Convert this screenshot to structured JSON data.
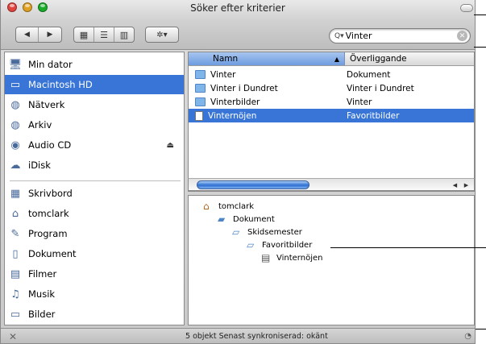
{
  "window": {
    "title": "Söker efter kriterier"
  },
  "toolbar": {
    "back_glyph": "◀",
    "forward_glyph": "▶",
    "view_icon_glyph": "▦",
    "view_list_glyph": "☰",
    "view_column_glyph": "▥",
    "action_glyph": "✲▾"
  },
  "search": {
    "value": "Vinter",
    "icon_glyph": "Q▾",
    "clear_glyph": "✕"
  },
  "sidebar": {
    "devices": [
      {
        "label": "Min dator",
        "icon": "computer-icon",
        "glyph": "🖥"
      },
      {
        "label": "Macintosh HD",
        "icon": "hard-disk-icon",
        "glyph": "▭",
        "selected": true
      },
      {
        "label": "Nätverk",
        "icon": "network-icon",
        "glyph": "◍"
      },
      {
        "label": "Arkiv",
        "icon": "archive-disk-icon",
        "glyph": "◍"
      },
      {
        "label": "Audio CD",
        "icon": "cd-icon",
        "glyph": "◉"
      },
      {
        "label": "iDisk",
        "icon": "idisk-icon",
        "glyph": "☁"
      }
    ],
    "eject_glyph": "⏏",
    "places": [
      {
        "label": "Skrivbord",
        "icon": "desktop-icon",
        "glyph": "▦"
      },
      {
        "label": "tomclark",
        "icon": "home-icon",
        "glyph": "⌂"
      },
      {
        "label": "Program",
        "icon": "applications-icon",
        "glyph": "✎"
      },
      {
        "label": "Dokument",
        "icon": "document-icon",
        "glyph": "▯"
      },
      {
        "label": "Filmer",
        "icon": "movies-icon",
        "glyph": "▤"
      },
      {
        "label": "Musik",
        "icon": "music-icon",
        "glyph": "♫"
      },
      {
        "label": "Bilder",
        "icon": "pictures-icon",
        "glyph": "▭"
      }
    ]
  },
  "filelist": {
    "columns": {
      "name": "Namn",
      "parent": "Överliggande"
    },
    "sort_glyph": "▲",
    "rows": [
      {
        "name": "Vinter",
        "parent": "Dokument",
        "icon": "folder-icon",
        "selected": false
      },
      {
        "name": "Vinter i Dundret",
        "parent": "Vinter i Dundret",
        "icon": "folder-icon",
        "selected": false
      },
      {
        "name": "Vinterbilder",
        "parent": "Vinter",
        "icon": "folder-icon",
        "selected": false
      },
      {
        "name": "Vinternöjen",
        "parent": "Favoritbilder",
        "icon": "file-icon",
        "selected": true
      }
    ]
  },
  "path": [
    {
      "label": "tomclark",
      "icon": "home-icon",
      "glyph": "⌂"
    },
    {
      "label": "Dokument",
      "icon": "document-folder-icon",
      "glyph": "▰"
    },
    {
      "label": "Skidsemester",
      "icon": "folder-icon",
      "glyph": "▱"
    },
    {
      "label": "Favoritbilder",
      "icon": "folder-icon",
      "glyph": "▱"
    },
    {
      "label": "Vinternöjen",
      "icon": "file-icon",
      "glyph": "▤"
    }
  ],
  "status": {
    "text": "5 objekt Senast synkroniserad: okänt"
  },
  "colors": {
    "selection": "#3875d7",
    "folder": "#7fb5e8",
    "close": "#e0443e",
    "minimize": "#dea123",
    "zoom": "#1aab29"
  }
}
